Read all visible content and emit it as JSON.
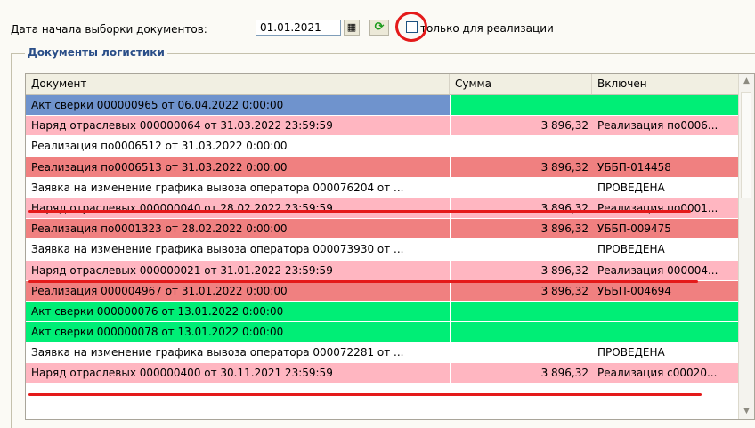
{
  "filter": {
    "date_label": "Дата начала выборки документов:",
    "date_value": "01.01.2021",
    "calendar_icon": "calendar-icon",
    "refresh_icon": "refresh-icon",
    "only_sales_label": "только для реализации",
    "only_sales_checked": false
  },
  "group": {
    "title": "Документы логистики"
  },
  "table": {
    "columns": [
      "Документ",
      "Сумма",
      "Включен"
    ],
    "rows": [
      {
        "doc": "Акт сверки 000000965 от 06.04.2022 0:00:00",
        "sum": "",
        "inc": "",
        "doc_color": "#6f93cd",
        "rest_color": "#00ee76"
      },
      {
        "doc": "Наряд отраслевых 000000064 от 31.03.2022 23:59:59",
        "sum": "3 896,32",
        "inc": "Реализация по0006...",
        "doc_color": "#ffb6c1",
        "rest_color": "#ffb6c1"
      },
      {
        "doc": "Реализация по0006512 от 31.03.2022 0:00:00",
        "sum": "",
        "inc": "",
        "doc_color": "#ffffff",
        "rest_color": "#ffffff"
      },
      {
        "doc": "Реализация по0006513 от 31.03.2022 0:00:00",
        "sum": "3 896,32",
        "inc": "УББП-014458",
        "doc_color": "#f08080",
        "rest_color": "#f08080"
      },
      {
        "doc": "Заявка на изменение графика вывоза оператора 000076204 от ...",
        "sum": "",
        "inc": "ПРОВЕДЕНА",
        "doc_color": "#ffffff",
        "rest_color": "#ffffff"
      },
      {
        "doc": "Наряд отраслевых 000000040 от 28.02.2022 23:59:59",
        "sum": "3 896,32",
        "inc": "Реализация по0001...",
        "doc_color": "#ffb6c1",
        "rest_color": "#ffb6c1"
      },
      {
        "doc": "Реализация по0001323 от 28.02.2022 0:00:00",
        "sum": "3 896,32",
        "inc": "УББП-009475",
        "doc_color": "#f08080",
        "rest_color": "#f08080"
      },
      {
        "doc": "Заявка на изменение графика вывоза оператора 000073930 от ...",
        "sum": "",
        "inc": "ПРОВЕДЕНА",
        "doc_color": "#ffffff",
        "rest_color": "#ffffff"
      },
      {
        "doc": "Наряд отраслевых 000000021 от 31.01.2022 23:59:59",
        "sum": "3 896,32",
        "inc": "Реализация 000004...",
        "doc_color": "#ffb6c1",
        "rest_color": "#ffb6c1"
      },
      {
        "doc": "Реализация 000004967 от 31.01.2022 0:00:00",
        "sum": "3 896,32",
        "inc": "УББП-004694",
        "doc_color": "#f08080",
        "rest_color": "#f08080"
      },
      {
        "doc": "Акт сверки 000000076 от 13.01.2022 0:00:00",
        "sum": "",
        "inc": "",
        "doc_color": "#00ee76",
        "rest_color": "#00ee76"
      },
      {
        "doc": "Акт сверки 000000078 от 13.01.2022 0:00:00",
        "sum": "",
        "inc": "",
        "doc_color": "#00ee76",
        "rest_color": "#00ee76"
      },
      {
        "doc": "Заявка на изменение графика вывоза оператора 000072281 от ...",
        "sum": "",
        "inc": "ПРОВЕДЕНА",
        "doc_color": "#ffffff",
        "rest_color": "#ffffff"
      },
      {
        "doc": "Наряд отраслевых 000000400 от 30.11.2021 23:59:59",
        "sum": "3 896,32",
        "inc": "Реализация с00020...",
        "doc_color": "#ffb6c1",
        "rest_color": "#ffb6c1"
      }
    ]
  },
  "annotation_color": "#e41a1a"
}
